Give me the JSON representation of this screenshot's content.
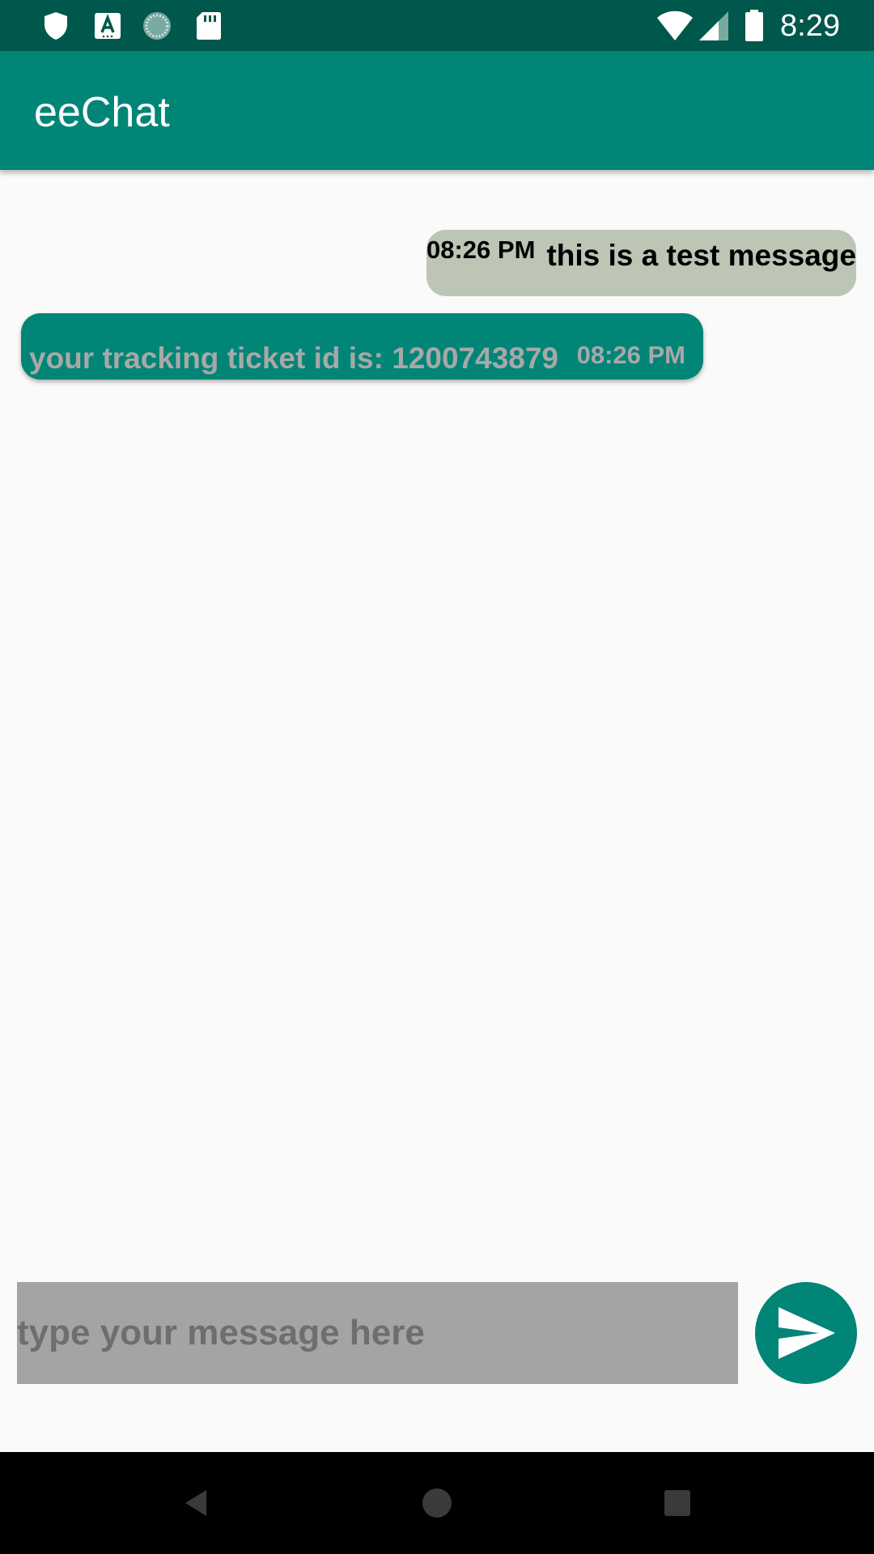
{
  "status_bar": {
    "time": "8:29",
    "left_icons": [
      "shield-icon",
      "font-a-icon",
      "sync-circle-icon",
      "sd-card-icon"
    ],
    "right_icons": [
      "wifi-icon",
      "cell-signal-icon",
      "battery-icon"
    ]
  },
  "app_bar": {
    "title": "eeChat",
    "color": "#008577"
  },
  "messages": [
    {
      "direction": "sent",
      "time": "08:26 PM",
      "text": "this is a test message",
      "bubble_color": "#bdc5b5"
    },
    {
      "direction": "received",
      "time": "08:26 PM",
      "text": "your tracking ticket id is: 1200743879",
      "bubble_color": "#008577"
    }
  ],
  "composer": {
    "placeholder": "type your message here",
    "value": "",
    "send_icon": "send-icon"
  },
  "nav_bar": {
    "buttons": [
      "back-icon",
      "home-icon",
      "recents-icon"
    ]
  }
}
